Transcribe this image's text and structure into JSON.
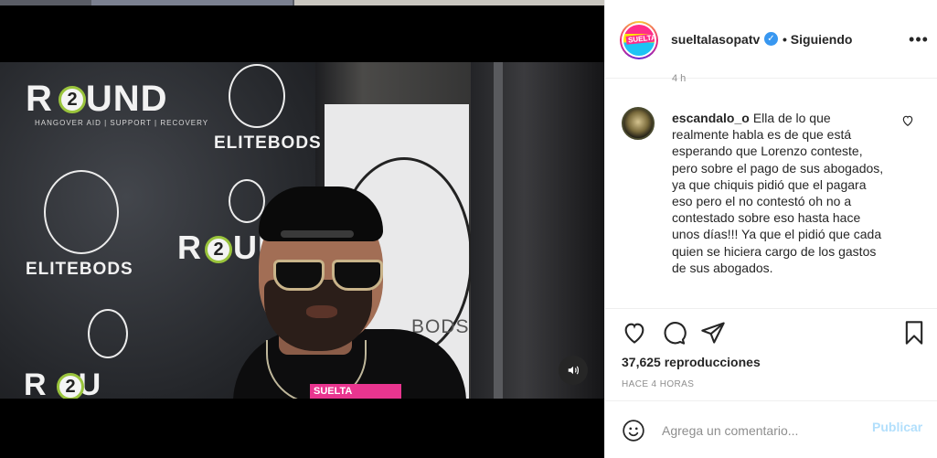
{
  "video": {
    "backdrop_texts": {
      "round": "R2UND",
      "round_sub": "HANGOVER AID  |  SUPPORT  |  RECOVERY",
      "elite": "ELITEBODS",
      "elite_alt": "ELITEBODS",
      "bods": "BODS.",
      "mic": "SUELTA"
    },
    "sound_icon": "volume-icon"
  },
  "header": {
    "username": "sueltalasopatv",
    "verified_icon": "verified-badge-icon",
    "separator": "•",
    "following": "Siguiendo",
    "more_icon": "more-options-icon",
    "avatar_text": "SUELTA"
  },
  "post": {
    "partial_timestamp": "4 h"
  },
  "comment": {
    "user": "escandalo_o",
    "text": "Ella de lo que realmente habla es de que está esperando que Lorenzo conteste, pero sobre el pago de sus abogados, ya que chiquis pidió que el pagara eso pero el no contestó oh no a contestado sobre eso hasta hace unos días!!! Ya que el pidió que cada quien se hiciera cargo de los gastos de sus abogados."
  },
  "actions": {
    "icons": [
      "heart-icon",
      "comment-icon",
      "share-icon",
      "bookmark-icon"
    ],
    "views": "37,625 reproducciones",
    "time_ago": "HACE 4 HORAS"
  },
  "add_comment": {
    "placeholder": "Agrega un comentario...",
    "publish_label": "Publicar"
  }
}
